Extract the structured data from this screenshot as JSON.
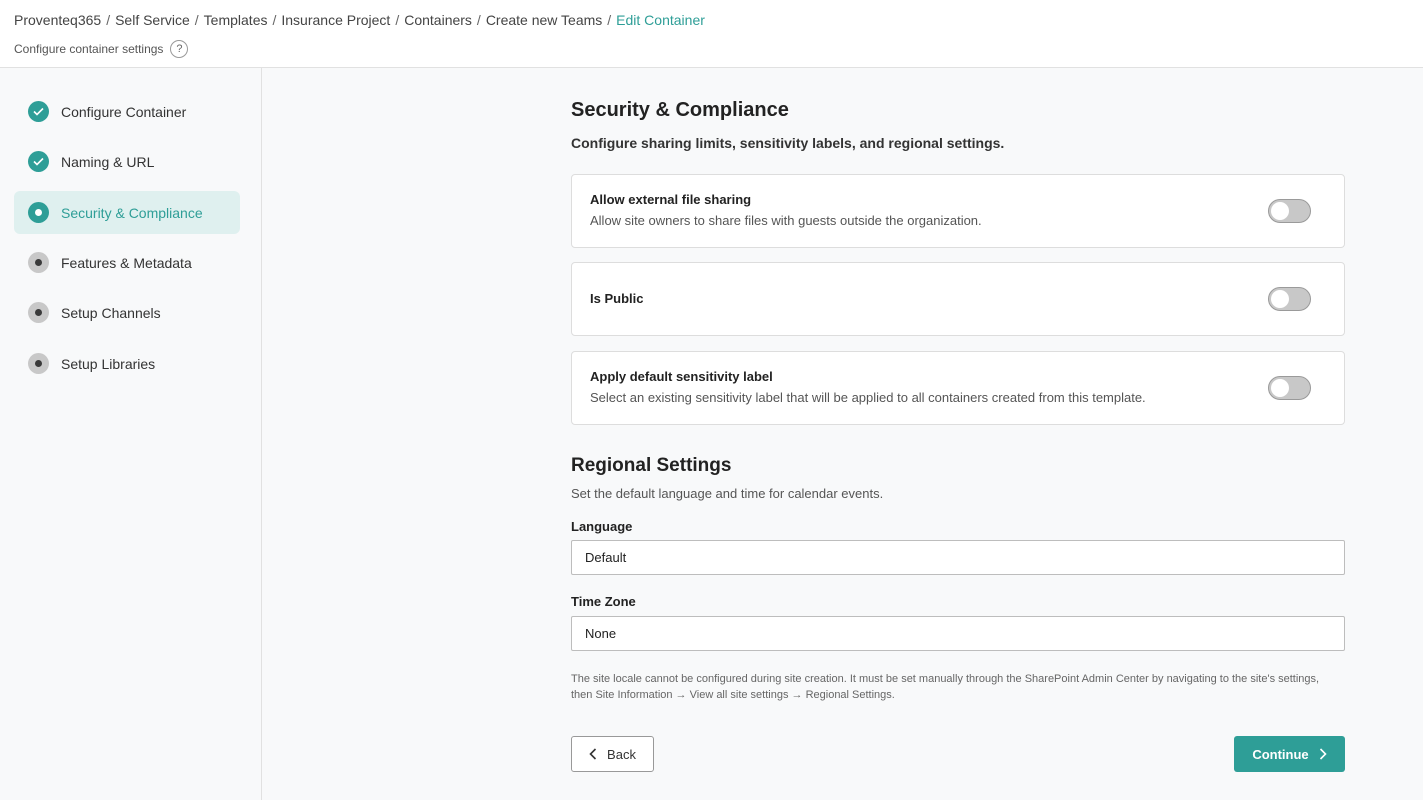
{
  "header": {
    "breadcrumb": [
      "Proventeq365",
      "Self Service",
      "Templates",
      "Insurance Project",
      "Containers",
      "Create new Teams",
      "Edit Container"
    ],
    "subtitle": "Configure container settings",
    "help_glyph": "?"
  },
  "sidebar": {
    "steps": [
      {
        "label": "Configure Container",
        "state": "done"
      },
      {
        "label": "Naming & URL",
        "state": "done"
      },
      {
        "label": "Security & Compliance",
        "state": "current"
      },
      {
        "label": "Features & Metadata",
        "state": "pending"
      },
      {
        "label": "Setup Channels",
        "state": "pending"
      },
      {
        "label": "Setup Libraries",
        "state": "pending"
      }
    ]
  },
  "security": {
    "title": "Security & Compliance",
    "description": "Configure sharing limits, sensitivity labels, and regional settings.",
    "options": [
      {
        "title": "Allow external file sharing",
        "description": "Allow site owners to share files with guests outside the organization.",
        "enabled": false
      },
      {
        "title": "Is Public",
        "description": "",
        "enabled": false
      },
      {
        "title": "Apply default sensitivity label",
        "description": "Select an existing sensitivity label that will be applied to all containers created from this template.",
        "enabled": false
      }
    ]
  },
  "regional": {
    "title": "Regional Settings",
    "description": "Set the default language and time for calendar events.",
    "language_label": "Language",
    "language_value": "Default",
    "timezone_label": "Time Zone",
    "timezone_value": "None",
    "note": "The site locale cannot be configured during site creation. It must be set manually through the SharePoint Admin Center by navigating to the site's settings, then Site Information → View all site settings → Regional Settings."
  },
  "footer": {
    "back_label": "Back",
    "continue_label": "Continue"
  },
  "colors": {
    "accent": "#2e9e97",
    "active_step_bg": "#dff0ef",
    "toggle_off": "#c8c8c8"
  }
}
